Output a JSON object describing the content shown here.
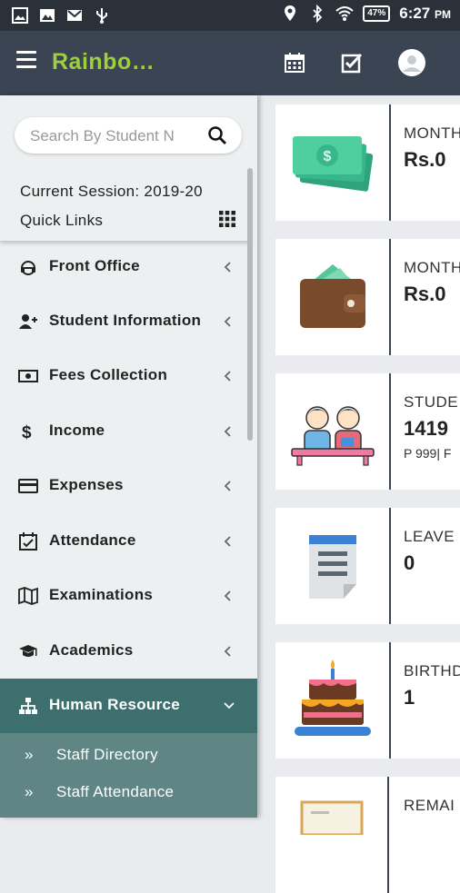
{
  "status_bar": {
    "battery": "47%",
    "time": "6:27",
    "ampm": "PM"
  },
  "app_bar": {
    "title": "Rainbo…"
  },
  "sidebar": {
    "search_placeholder": "Search By Student N",
    "current_session": "Current Session: 2019-20",
    "quick_links": "Quick Links",
    "items": [
      {
        "label": "Front Office",
        "icon": "headset-icon"
      },
      {
        "label": "Student Information",
        "icon": "user-plus-icon"
      },
      {
        "label": "Fees Collection",
        "icon": "money-icon"
      },
      {
        "label": "Income",
        "icon": "dollar-icon"
      },
      {
        "label": "Expenses",
        "icon": "credit-card-icon"
      },
      {
        "label": "Attendance",
        "icon": "calendar-check-icon"
      },
      {
        "label": "Examinations",
        "icon": "map-icon"
      },
      {
        "label": "Academics",
        "icon": "graduation-cap-icon"
      },
      {
        "label": "Human Resource",
        "icon": "sitemap-icon",
        "active": true
      }
    ],
    "sub_items": [
      {
        "label": "Staff Directory"
      },
      {
        "label": "Staff Attendance"
      }
    ]
  },
  "cards": [
    {
      "label": "MONTH",
      "value": "Rs.0",
      "icon": "cash-icon"
    },
    {
      "label": "MONTH",
      "value": "Rs.0",
      "icon": "wallet-icon"
    },
    {
      "label": "STUDE",
      "value": "1419",
      "sub": "P 999| F",
      "icon": "students-icon"
    },
    {
      "label": "LEAVE",
      "value": "0",
      "icon": "document-icon"
    },
    {
      "label": "BIRTHD",
      "value": "1",
      "icon": "cake-icon"
    },
    {
      "label": "REMAI",
      "value": "",
      "icon": "certificate-icon"
    }
  ],
  "colors": {
    "status_bar": "#2a3139",
    "app_bar": "#3a4452",
    "title_green": "#9dd03a",
    "active_nav": "#3d6f6f",
    "submenu": "#5f8585"
  }
}
